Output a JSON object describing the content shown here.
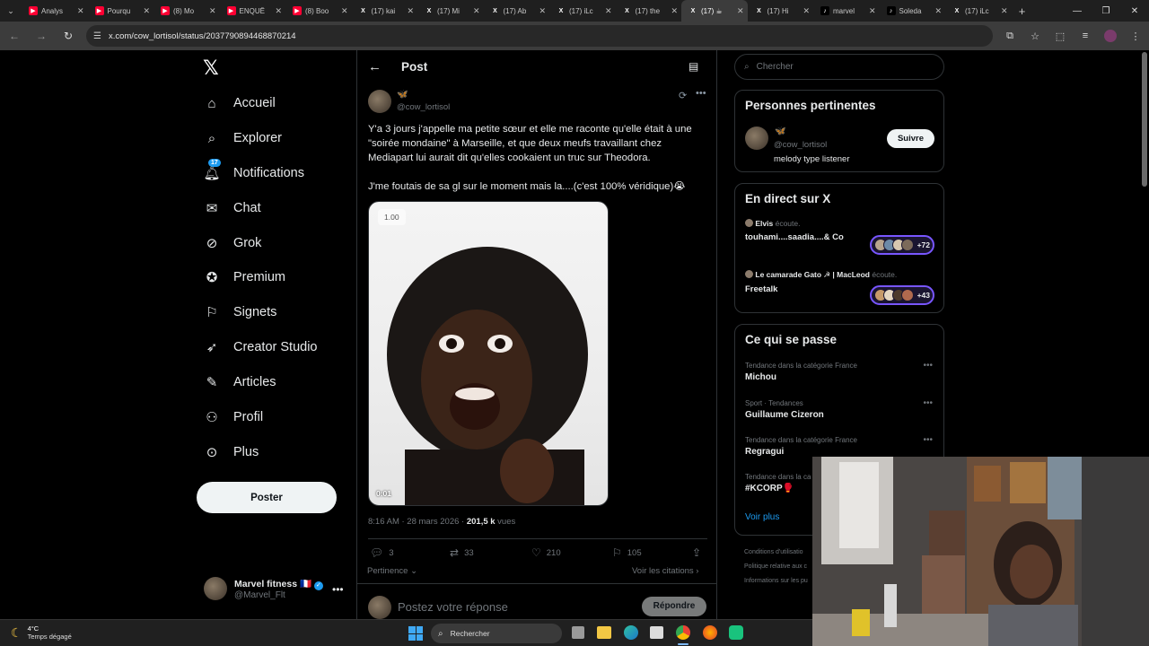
{
  "browser": {
    "tabs": [
      {
        "label": "Analys",
        "icon": "youtube-icon",
        "color": "#ff0033"
      },
      {
        "label": "Pourqu",
        "icon": "youtube-icon",
        "color": "#ff0033"
      },
      {
        "label": "(8) Mo",
        "icon": "youtube-icon",
        "color": "#ff0033"
      },
      {
        "label": "ENQUÊ",
        "icon": "youtube-icon",
        "color": "#ff0033"
      },
      {
        "label": "(8) Boo",
        "icon": "youtube-icon",
        "color": "#ff0033"
      },
      {
        "label": "(17) kai",
        "icon": "x-icon",
        "color": "#000000"
      },
      {
        "label": "(17) Mi",
        "icon": "x-icon",
        "color": "#000000"
      },
      {
        "label": "(17) Ab",
        "icon": "x-icon",
        "color": "#000000"
      },
      {
        "label": "(17) iLc",
        "icon": "x-icon",
        "color": "#000000"
      },
      {
        "label": "(17) the",
        "icon": "x-icon",
        "color": "#000000"
      },
      {
        "label": "(17) ☕",
        "icon": "x-icon",
        "color": "#000000",
        "active": true
      },
      {
        "label": "(17) Hi",
        "icon": "x-icon",
        "color": "#000000"
      },
      {
        "label": "marvel",
        "icon": "tiktok-icon",
        "color": "#000000"
      },
      {
        "label": "Soleda",
        "icon": "tiktok-icon",
        "color": "#000000"
      },
      {
        "label": "(17) iLc",
        "icon": "x-icon",
        "color": "#000000"
      }
    ],
    "url": "x.com/cow_lortisol/status/2037790894468870214"
  },
  "sidebar": {
    "logo": "𝕏",
    "items": [
      {
        "label": "Accueil",
        "icon": "home-icon"
      },
      {
        "label": "Explorer",
        "icon": "search-icon"
      },
      {
        "label": "Notifications",
        "icon": "bell-icon",
        "badge": "17"
      },
      {
        "label": "Chat",
        "icon": "mail-icon"
      },
      {
        "label": "Grok",
        "icon": "grok-icon"
      },
      {
        "label": "Premium",
        "icon": "premium-icon"
      },
      {
        "label": "Signets",
        "icon": "bookmark-icon"
      },
      {
        "label": "Creator Studio",
        "icon": "rocket-icon"
      },
      {
        "label": "Articles",
        "icon": "article-icon"
      },
      {
        "label": "Profil",
        "icon": "person-icon"
      },
      {
        "label": "Plus",
        "icon": "more-circle-icon"
      }
    ],
    "post_button": "Poster",
    "account": {
      "name": "Marvel fitness",
      "flag": "🇫🇷",
      "handle": "@Marvel_Flt"
    }
  },
  "main": {
    "header_title": "Post",
    "author_handle": "@cow_lortisol",
    "tweet_lines": [
      "Y'a 3 jours j'appelle ma petite sœur et elle me raconte qu'elle était à une \"soirée mondaine\" à Marseille, et que deux meufs travaillant chez Mediapart lui aurait dit qu'elles cookaient un truc sur Theodora.",
      "J'me foutais de sa gl sur le moment mais la....(c'est 100% véridique)😭"
    ],
    "video": {
      "speed": "1.00",
      "time": "0:01"
    },
    "timestamp": "8:16 AM · 28 mars 2026 · ",
    "views_count": "201,5 k",
    "views_label": " vues",
    "actions": {
      "replies": "3",
      "reposts": "33",
      "likes": "210",
      "bookmarks": "105"
    },
    "sort_label": "Pertinence",
    "quotes_link": "Voir les citations",
    "reply_placeholder": "Postez votre réponse",
    "reply_button": "Répondre"
  },
  "right": {
    "search_placeholder": "Chercher",
    "relevant": {
      "title": "Personnes pertinentes",
      "handle": "@cow_lortisol",
      "bio": "melody type listener",
      "follow": "Suivre"
    },
    "live": {
      "title": "En direct sur X",
      "items": [
        {
          "host": "Elvis",
          "status": " écoute.",
          "name": "touhami....saadia....& Co",
          "count": "+72"
        },
        {
          "host": "Le camarade Gato ☭ | MacLeod",
          "status": " écoute.",
          "name": "Freetalk",
          "count": "+43"
        }
      ]
    },
    "trends": {
      "title": "Ce qui se passe",
      "items": [
        {
          "category": "Tendance dans la catégorie France",
          "name": "Michou"
        },
        {
          "category": "Sport · Tendances",
          "name": "Guillaume Cizeron"
        },
        {
          "category": "Tendance dans la catégorie France",
          "name": "Regragui"
        },
        {
          "category": "Tendance dans la ca",
          "name": "#KCORP🥊"
        }
      ],
      "more": "Voir plus"
    },
    "footer": [
      "Conditions d'utilisatio",
      "Politique relative aux c",
      "Informations sur les pu"
    ]
  },
  "taskbar": {
    "weather_temp": "4°C",
    "weather_desc": "Temps dégagé",
    "search_label": "Rechercher"
  },
  "colors": {
    "accent": "#1d9bf0",
    "live_border": "#7856ff",
    "background": "#000000"
  }
}
